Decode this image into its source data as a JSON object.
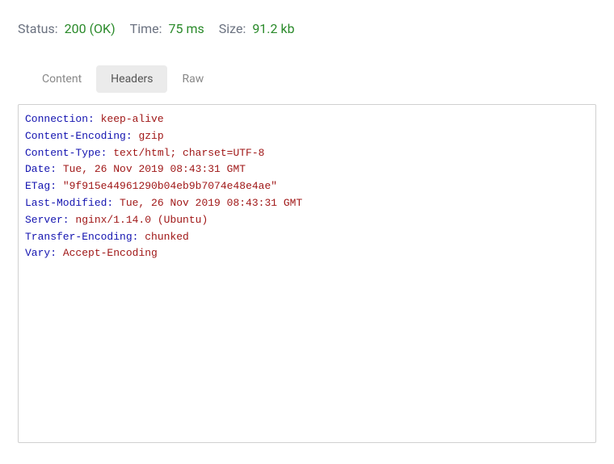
{
  "status": {
    "status_label": "Status:",
    "status_value": "200 (OK)",
    "time_label": "Time:",
    "time_value": "75 ms",
    "size_label": "Size:",
    "size_value": "91.2 kb"
  },
  "tabs": {
    "content": "Content",
    "headers": "Headers",
    "raw": "Raw"
  },
  "headers": [
    {
      "key": "Connection:",
      "value": "keep-alive"
    },
    {
      "key": "Content-Encoding:",
      "value": "gzip"
    },
    {
      "key": "Content-Type:",
      "value": "text/html; charset=UTF-8"
    },
    {
      "key": "Date:",
      "value": "Tue, 26 Nov 2019 08:43:31 GMT"
    },
    {
      "key": "ETag:",
      "value": "\"9f915e44961290b04eb9b7074e48e4ae\""
    },
    {
      "key": "Last-Modified:",
      "value": "Tue, 26 Nov 2019 08:43:31 GMT"
    },
    {
      "key": "Server:",
      "value": "nginx/1.14.0 (Ubuntu)"
    },
    {
      "key": "Transfer-Encoding:",
      "value": "chunked"
    },
    {
      "key": "Vary:",
      "value": "Accept-Encoding"
    }
  ]
}
